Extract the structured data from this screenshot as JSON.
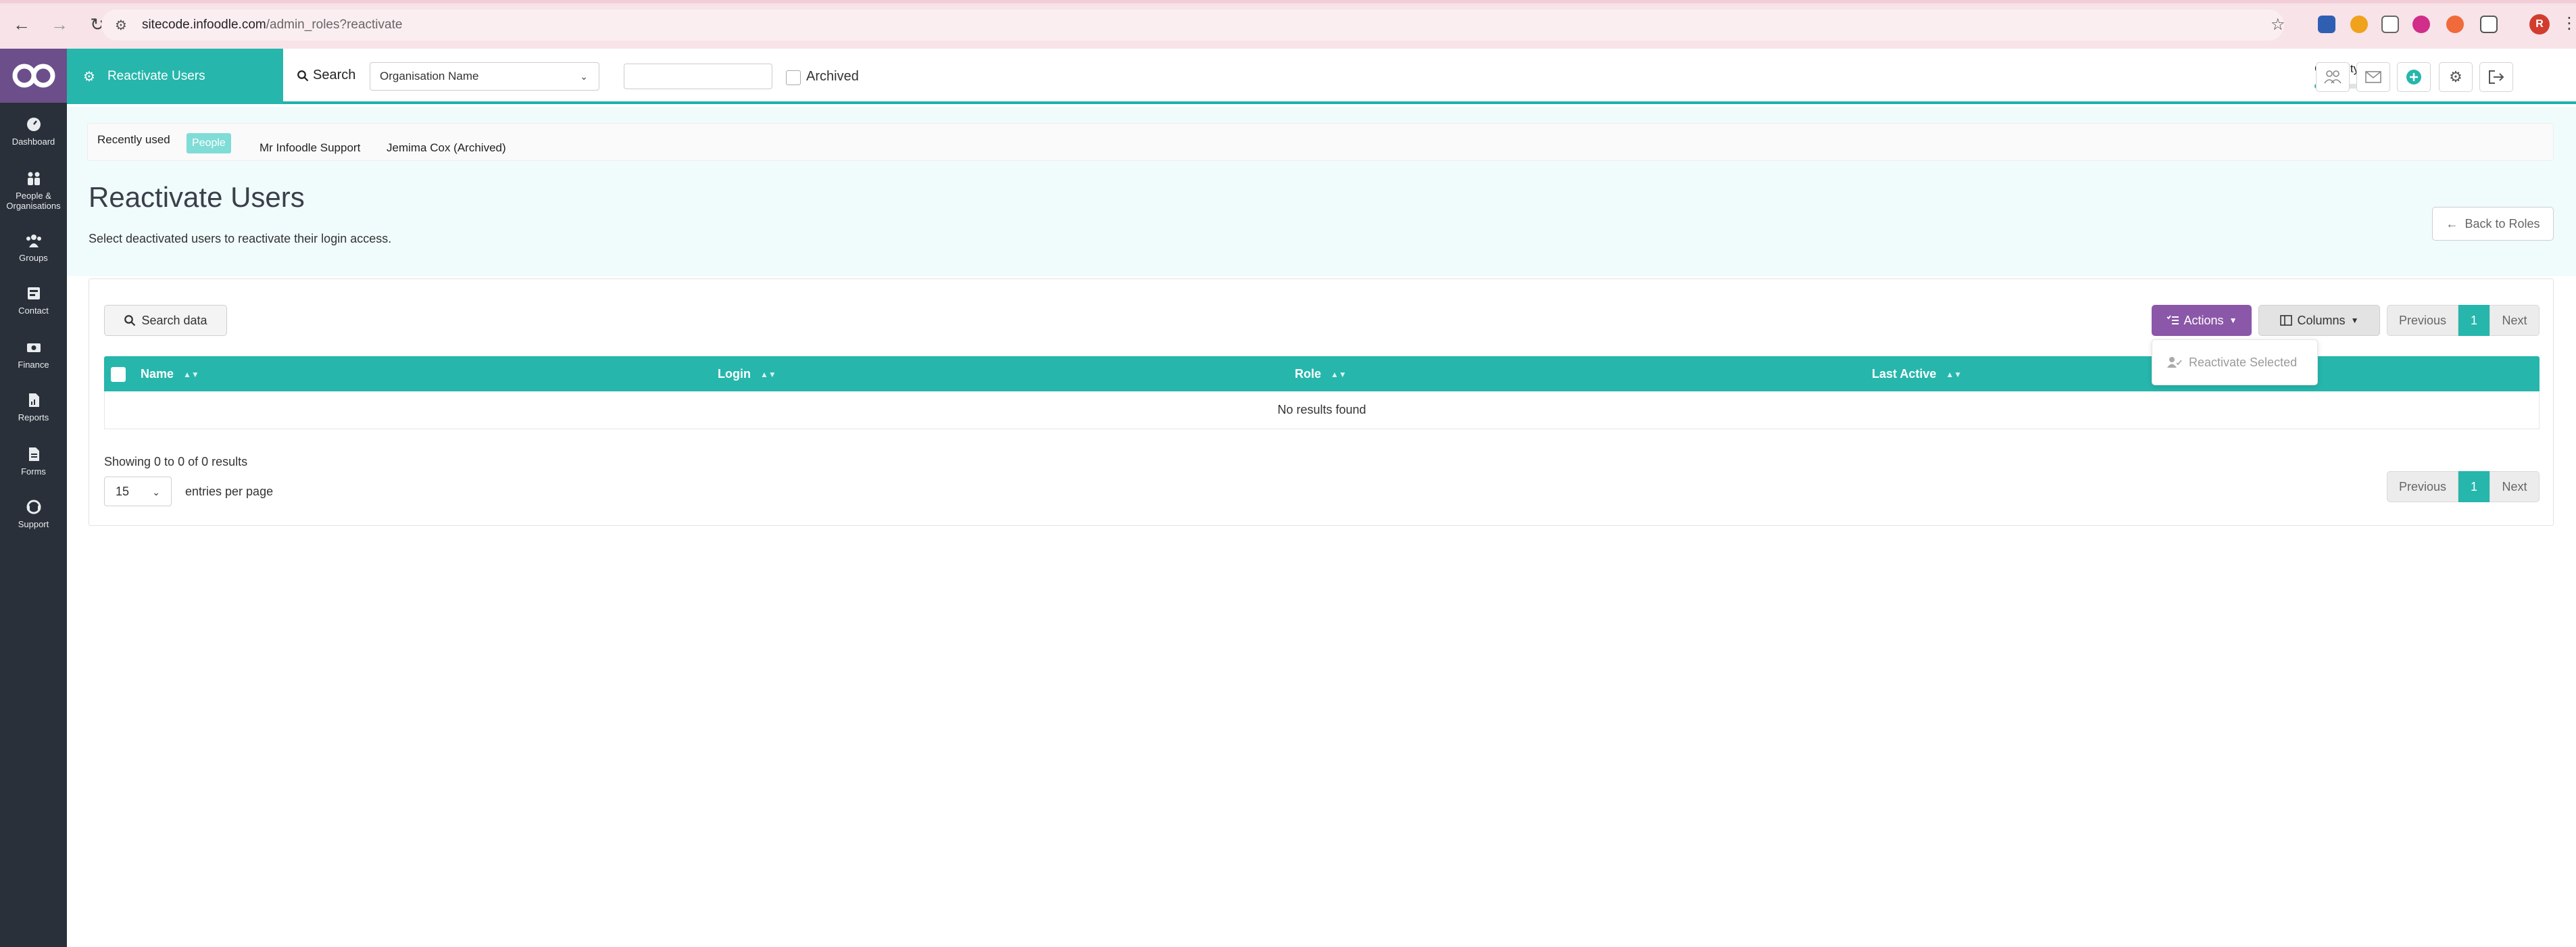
{
  "browser": {
    "url_host": "sitecode.infoodle.com",
    "url_path": "/admin_roles?reactivate",
    "profile_initial": "R"
  },
  "sidebar": {
    "items": [
      {
        "label": "Dashboard",
        "icon": "dashboard-icon"
      },
      {
        "label": "People & Organisations",
        "icon": "people-icon"
      },
      {
        "label": "Groups",
        "icon": "groups-icon"
      },
      {
        "label": "Contact",
        "icon": "contact-icon"
      },
      {
        "label": "Finance",
        "icon": "finance-icon"
      },
      {
        "label": "Reports",
        "icon": "reports-icon"
      },
      {
        "label": "Forms",
        "icon": "forms-icon"
      },
      {
        "label": "Support",
        "icon": "support-icon"
      }
    ]
  },
  "header": {
    "page_tab": "Reactivate Users",
    "search_label": "Search",
    "search_type": "Organisation Name",
    "search_value": "",
    "archived_label": "Archived",
    "capacity_label": "Capacity",
    "capacity_level": 0.45
  },
  "recent": {
    "label": "Recently used",
    "chip": "People",
    "links": [
      "Mr Infoodle Support",
      "Jemima Cox (Archived)"
    ]
  },
  "page": {
    "title": "Reactivate Users",
    "subtitle": "Select deactivated users to reactivate their login access.",
    "back_label": "Back to Roles"
  },
  "table": {
    "search_label": "Search data",
    "actions_label": "Actions",
    "columns_label": "Columns",
    "pager": {
      "previous": "Previous",
      "current": "1",
      "next": "Next"
    },
    "headers": [
      "Name",
      "Login",
      "Role",
      "Last Active"
    ],
    "empty_text": "No results found",
    "showing_text": "Showing 0 to 0 of 0 results",
    "per_page_value": "15",
    "per_page_label": "entries per page"
  },
  "actions_menu": {
    "items": [
      "Reactivate Selected"
    ]
  },
  "colors": {
    "teal": "#26b6ac",
    "purple": "#8b57a8",
    "sidebar": "#2a3039"
  }
}
